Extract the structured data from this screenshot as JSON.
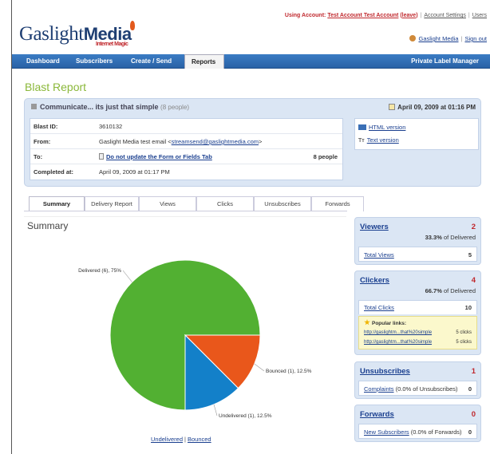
{
  "header": {
    "account_prefix": "Using Account:",
    "account_name": "Test Account Test Account",
    "leave_label": "leave",
    "account_settings": "Account Settings",
    "users": "Users",
    "logo_main": "Gaslight",
    "logo_media": "Media",
    "logo_sub": "Internet Magic",
    "user_name": "Gaslight Media",
    "sign_out": "Sign out"
  },
  "nav": {
    "items": [
      "Dashboard",
      "Subscribers",
      "Create / Send",
      "Reports"
    ],
    "active": "Reports",
    "right": "Private Label Manager"
  },
  "page": {
    "title": "Blast Report"
  },
  "blast": {
    "subject": "Communicate... its just that simple",
    "people": "(8 people)",
    "date": "April 09, 2009 at 01:16 PM",
    "id_label": "Blast ID:",
    "id_value": "3610132",
    "from_label": "From:",
    "from_value": "Gaslight Media test email <",
    "from_email": "streamsend@gaslightmedia.com",
    "from_close": ">",
    "to_label": "To:",
    "to_value": "Do not update the Form or Fields Tab",
    "to_count": "8 people",
    "completed_label": "Completed at:",
    "completed_value": "April 09, 2009 at 01:17 PM",
    "html_version": "HTML version",
    "text_version": "Text version",
    "text_icon": "Tт"
  },
  "tabs": [
    "Summary",
    "Delivery Report",
    "Views",
    "Clicks",
    "Unsubscribes",
    "Forwards"
  ],
  "summary": {
    "heading": "Summary",
    "link_undelivered": "Undelivered",
    "link_separator": "|",
    "link_bounced": "Bounced"
  },
  "chart_data": {
    "type": "pie",
    "slices": [
      {
        "label": "Delivered (6), 75%",
        "value": 75,
        "count": 6,
        "color": "#52b032"
      },
      {
        "label": "Bounced (1), 12.5%",
        "value": 12.5,
        "count": 1,
        "color": "#e9571b"
      },
      {
        "label": "Undelivered (1), 12.5%",
        "value": 12.5,
        "count": 1,
        "color": "#1380c9"
      }
    ]
  },
  "stats": {
    "viewers": {
      "title": "Viewers",
      "count": "2",
      "pct": "33.3%",
      "pct_suffix": "of Delivered",
      "total_label": "Total Views",
      "total_value": "5"
    },
    "clickers": {
      "title": "Clickers",
      "count": "4",
      "pct": "66.7%",
      "pct_suffix": "of Delivered",
      "total_label": "Total Clicks",
      "total_value": "10",
      "popular_title": "Popular links:",
      "links": [
        {
          "url": "http://gaslightm...that%20simple",
          "clicks": "5 clicks"
        },
        {
          "url": "http://gaslightm...that%20simple",
          "clicks": "5 clicks"
        }
      ]
    },
    "unsubscribes": {
      "title": "Unsubscribes",
      "count": "1",
      "sub_label": "Complaints",
      "sub_text": "(0.0% of Unsubscribes)",
      "sub_value": "0"
    },
    "forwards": {
      "title": "Forwards",
      "count": "0",
      "sub_label": "New Subscribers",
      "sub_text": "(0.0% of Forwards)",
      "sub_value": "0"
    }
  },
  "colors": {
    "nav_blue": "#2f6db3",
    "title_green": "#8bb83a",
    "panel_blue": "#dbe6f4",
    "count_red": "#c0282d"
  }
}
